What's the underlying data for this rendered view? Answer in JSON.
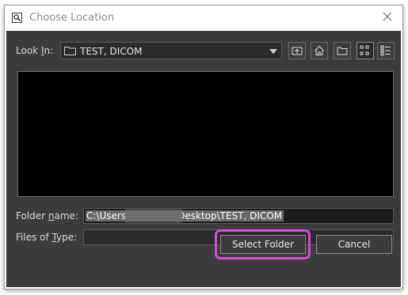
{
  "window": {
    "title": "Choose Location"
  },
  "look_in": {
    "label_pre": "Look ",
    "label_key": "I",
    "label_post": "n:",
    "value": "TEST, DICOM"
  },
  "toolbar": {
    "icons": [
      "up-one-level-icon",
      "home-icon",
      "new-folder-icon",
      "list-view-icon",
      "details-view-icon"
    ]
  },
  "folder_name": {
    "label_pre": "Folder ",
    "label_key": "n",
    "label_post": "ame:",
    "value": "C:\\Users\\                Desktop\\TEST, DICOM"
  },
  "files_of_type": {
    "label_pre": "Files of ",
    "label_key": "T",
    "label_post": "ype:",
    "value": ""
  },
  "buttons": {
    "select": "Select Folder",
    "cancel": "Cancel"
  },
  "colors": {
    "panel": "#3c3c3c",
    "list_bg": "#000000",
    "highlight": "#d54fd8"
  }
}
